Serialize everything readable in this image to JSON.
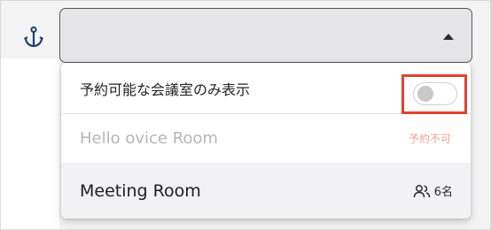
{
  "select": {
    "value": ""
  },
  "dropdown": {
    "filter_label": "予約可能な会議室のみ表示",
    "filter_toggle_on": false,
    "rooms": [
      {
        "name": "Hello ovice Room",
        "status": "予約不可",
        "disabled": true
      },
      {
        "name": "Meeting Room",
        "capacity": "6名",
        "disabled": false
      }
    ]
  },
  "icons": {
    "left": "anchor-icon",
    "select_arrow": "caret-up-icon",
    "capacity": "people-icon"
  },
  "colors": {
    "highlight": "#e0412f",
    "unavailable_text": "#f0a391",
    "disabled_text": "#b6b6b6"
  }
}
